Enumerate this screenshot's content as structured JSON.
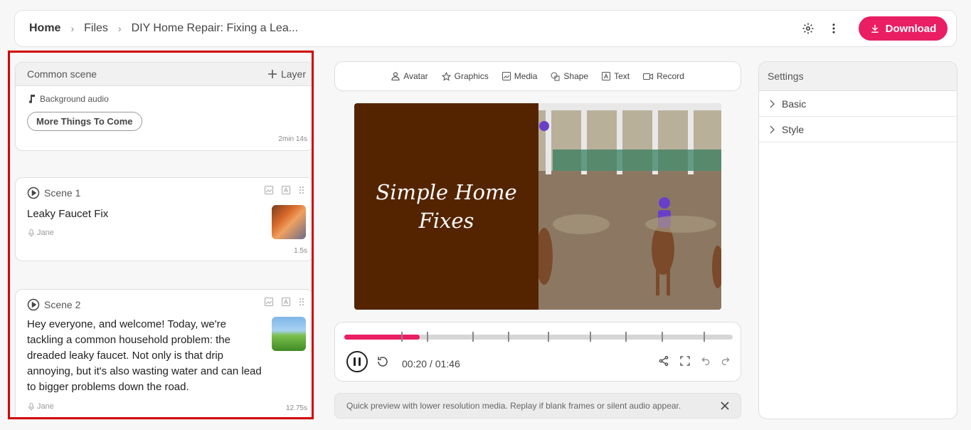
{
  "header": {
    "breadcrumbs": [
      "Home",
      "Files",
      "DIY Home Repair: Fixing a Lea..."
    ],
    "download_label": "Download",
    "accent": "#e91e63"
  },
  "common_scene": {
    "title": "Common scene",
    "layer_label": "Layer",
    "bg_audio_label": "Background audio",
    "pill_label": "More Things To Come",
    "duration": "2min 14s"
  },
  "scenes": [
    {
      "label": "Scene 1",
      "text": "Leaky Faucet Fix",
      "voice": "Jane",
      "duration": "1.5s"
    },
    {
      "label": "Scene 2",
      "text": "Hey everyone, and welcome! Today, we're tackling a common household problem: the dreaded leaky faucet. Not only is that drip annoying, but it's also wasting water and can lead to bigger problems down the road.",
      "voice": "Jane",
      "duration": "12.75s"
    }
  ],
  "toolbar": {
    "items": [
      "Avatar",
      "Graphics",
      "Media",
      "Shape",
      "Text",
      "Record"
    ]
  },
  "preview": {
    "title": "Simple Home Fixes",
    "bg_color": "#542400"
  },
  "player": {
    "time": "00:20 / 01:46",
    "progress": 0.195
  },
  "notice": {
    "text": "Quick preview with lower resolution media. Replay if blank frames or silent audio appear."
  },
  "settings": {
    "title": "Settings",
    "sections": [
      "Basic",
      "Style"
    ]
  }
}
